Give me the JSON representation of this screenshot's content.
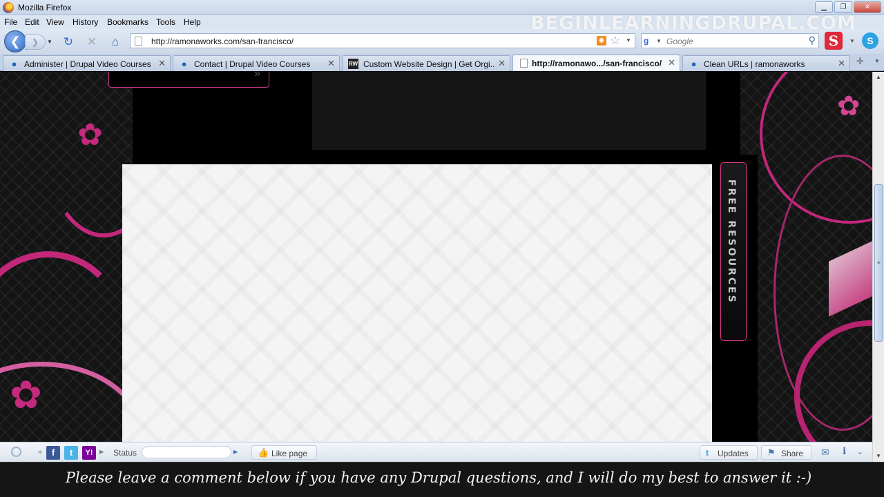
{
  "window": {
    "title": "Mozilla Firefox",
    "min_glyph": "▁",
    "restore_glyph": "❐",
    "close_glyph": "✕"
  },
  "watermark": "BEGINLEARNINGDRUPAL.COM",
  "menu": [
    "File",
    "Edit",
    "View",
    "History",
    "Bookmarks",
    "Tools",
    "Help"
  ],
  "nav": {
    "back_glyph": "❮",
    "forward_glyph": "❯",
    "reload_glyph": "↻",
    "stop_glyph": "✕",
    "home_glyph": "⌂",
    "url": "http://ramonaworks.com/san-francisco/",
    "search_placeholder": "Google",
    "search_engine_glyph": "g",
    "s_addon_glyph": "S",
    "skype_glyph": "S"
  },
  "tabs": [
    {
      "label": "Administer | Drupal Video Courses",
      "icon": "drupal-icon",
      "active": false
    },
    {
      "label": "Contact | Drupal Video Courses",
      "icon": "drupal-icon",
      "active": false
    },
    {
      "label": "Custom Website Design | Get Orgi...",
      "icon": "rw-icon",
      "icon_text": "RW",
      "active": false
    },
    {
      "label": "http://ramonawo.../san-francisco/",
      "icon": "blank-page-icon",
      "active": true
    },
    {
      "label": "Clean URLs | ramonaworks",
      "icon": "drupal-icon",
      "active": false
    }
  ],
  "page": {
    "free_resources": "FREE RESOURCES",
    "accent_color": "#d93a8e"
  },
  "addon_bar": {
    "status_label": "Status",
    "status_value": "",
    "like_label": "Like page",
    "updates_label": "Updates",
    "share_label": "Share"
  },
  "caption": "Please leave a comment below if you have any Drupal questions, and I will do my best to answer it :-)"
}
